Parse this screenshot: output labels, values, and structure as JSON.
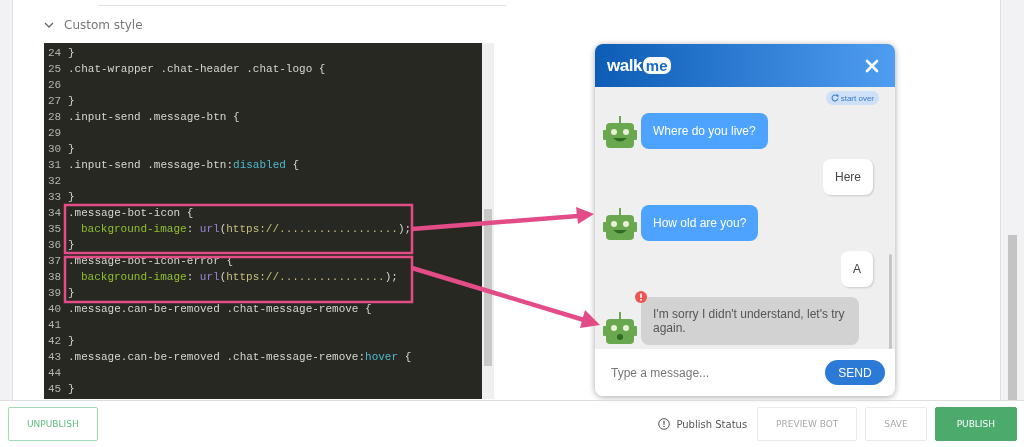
{
  "section": {
    "title": "Custom style",
    "expanded": true
  },
  "code_lines": [
    {
      "number": "24",
      "tokens": [
        {
          "kind": "plain",
          "text": "}"
        }
      ]
    },
    {
      "number": "25",
      "tokens": [
        {
          "kind": "plain",
          "text": ".chat-wrapper .chat-header .chat-logo {"
        }
      ]
    },
    {
      "number": "26"
    },
    {
      "number": "27",
      "tokens": [
        {
          "kind": "plain",
          "text": "}"
        }
      ]
    },
    {
      "number": "28",
      "tokens": [
        {
          "kind": "plain",
          "text": ".input-send .message-btn {"
        }
      ]
    },
    {
      "number": "29"
    },
    {
      "number": "30",
      "tokens": [
        {
          "kind": "plain",
          "text": "}"
        }
      ]
    },
    {
      "number": "31",
      "tokens": [
        {
          "kind": "plain",
          "text": ".input-send .message-btn:"
        },
        {
          "kind": "pseudo",
          "text": "disabled"
        },
        {
          "kind": "plain",
          "text": " {"
        }
      ]
    },
    {
      "number": "32"
    },
    {
      "number": "33",
      "tokens": [
        {
          "kind": "plain",
          "text": "}"
        }
      ]
    },
    {
      "number": "34",
      "tokens": [
        {
          "kind": "plain",
          "text": ".message-bot-icon {"
        }
      ]
    },
    {
      "number": "35",
      "indented": true,
      "tokens": [
        {
          "kind": "prop",
          "text": "background-image"
        },
        {
          "kind": "plain",
          "text": ": "
        },
        {
          "kind": "func",
          "text": "url"
        },
        {
          "kind": "plain",
          "text": "("
        },
        {
          "kind": "str",
          "text": "https://.................."
        },
        {
          "kind": "plain",
          "text": ");"
        }
      ]
    },
    {
      "number": "36",
      "tokens": [
        {
          "kind": "plain",
          "text": "}"
        }
      ]
    },
    {
      "number": "37",
      "tokens": [
        {
          "kind": "plain",
          "text": ".message-bot-icon-error {"
        }
      ]
    },
    {
      "number": "38",
      "indented": true,
      "tokens": [
        {
          "kind": "prop",
          "text": "background-image"
        },
        {
          "kind": "plain",
          "text": ": "
        },
        {
          "kind": "func",
          "text": "url"
        },
        {
          "kind": "plain",
          "text": "("
        },
        {
          "kind": "str",
          "text": "https://................"
        },
        {
          "kind": "plain",
          "text": ");"
        }
      ]
    },
    {
      "number": "39",
      "tokens": [
        {
          "kind": "plain",
          "text": "}"
        }
      ]
    },
    {
      "number": "40",
      "tokens": [
        {
          "kind": "plain",
          "text": ".message.can-be-removed .chat-message-remove {"
        }
      ]
    },
    {
      "number": "41"
    },
    {
      "number": "42",
      "tokens": [
        {
          "kind": "plain",
          "text": "}"
        }
      ]
    },
    {
      "number": "43",
      "tokens": [
        {
          "kind": "plain",
          "text": ".message.can-be-removed .chat-message-remove:"
        },
        {
          "kind": "pseudo",
          "text": "hover"
        },
        {
          "kind": "plain",
          "text": " {"
        }
      ]
    },
    {
      "number": "44"
    },
    {
      "number": "45",
      "tokens": [
        {
          "kind": "plain",
          "text": "}"
        }
      ]
    }
  ],
  "chat": {
    "logo": {
      "word": "walk",
      "badge": "me"
    },
    "start_over": "start over",
    "messages": [
      {
        "kind": "bot",
        "error": false,
        "text": "Where do you live?"
      },
      {
        "kind": "user",
        "error": false,
        "text": "Here"
      },
      {
        "kind": "bot",
        "error": false,
        "text": "How old are you?"
      },
      {
        "kind": "user",
        "error": false,
        "text": "A"
      },
      {
        "kind": "bot",
        "error": true,
        "text": "I'm sorry I didn't understand, let's try again."
      }
    ],
    "input": {
      "placeholder": "Type a message..."
    },
    "send": "SEND"
  },
  "footer": {
    "left_buttons": [
      {
        "label": "UNPUBLISH",
        "kind": "outline",
        "disabled": false
      }
    ],
    "status": "Publish Status",
    "right_buttons": [
      {
        "label": "PREVIEW BOT",
        "kind": "plain",
        "disabled": true
      },
      {
        "label": "SAVE",
        "kind": "plain",
        "disabled": true
      },
      {
        "label": "PUBLISH",
        "kind": "primary",
        "disabled": false
      }
    ]
  }
}
